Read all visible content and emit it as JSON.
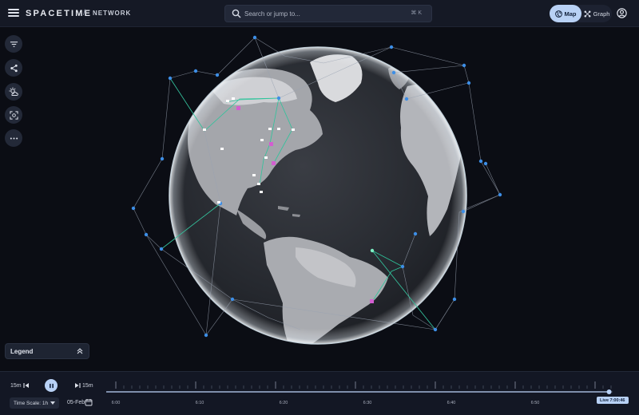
{
  "header": {
    "brand": "SPACETIME",
    "separator": "/",
    "section": "NETWORK",
    "search_placeholder": "Search or jump to...",
    "search_shortcut": "⌘ K",
    "view_map_label": "Map",
    "view_graph_label": "Graph"
  },
  "tools": [
    {
      "icon": "filter-icon"
    },
    {
      "icon": "share-nodes-icon"
    },
    {
      "icon": "weather-icon"
    },
    {
      "icon": "focus-icon"
    },
    {
      "icon": "more-icon"
    }
  ],
  "legend": {
    "label": "Legend"
  },
  "timeline": {
    "rewind_label": "15m",
    "forward_label": "15m",
    "time_scale_label": "Time Scale: 1h",
    "date_label": "05-Feb",
    "ticks": [
      "6:00",
      "6:10",
      "6:20",
      "6:30",
      "6:40",
      "6:50"
    ],
    "live_label": "Live 7:00:46",
    "progress": 0.993
  },
  "colors": {
    "accent": "#b8d1f5",
    "satellite": "#3d8ee6",
    "ground_station": "#ffffff",
    "highlight": "#d35fd0",
    "link": "#2ec49b"
  }
}
